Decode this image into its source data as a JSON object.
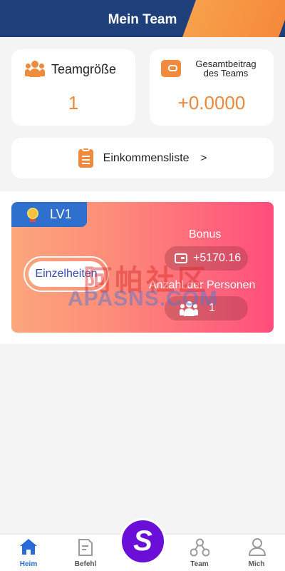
{
  "header": {
    "title": "Mein Team"
  },
  "stats": {
    "team_size": {
      "label": "Teamgröße",
      "value": "1",
      "icon": "people-icon"
    },
    "team_contribution": {
      "label_line1": "Gesamtbeitrag",
      "label_line2": "des Teams",
      "value": "+0.0000",
      "icon": "wallet-icon"
    }
  },
  "income_list": {
    "label": "Einkommensliste",
    "arrow": ">",
    "icon": "clipboard-icon"
  },
  "level": {
    "tag": "LV1",
    "details_button": "Einzelheiten",
    "bonus_label": "Bonus",
    "bonus_value": "+5170.16",
    "persons_label": "Anzahl der Personen",
    "persons_value": "1"
  },
  "watermark": {
    "chinese": "阿帕社区",
    "latin": "APASNS.COM"
  },
  "nav": {
    "home": "Heim",
    "order": "Befehl",
    "center": "S",
    "team": "Team",
    "me": "Mich"
  },
  "colors": {
    "header": "#1f3f7a",
    "accent_orange": "#f08a3c",
    "value_orange": "#e8893f",
    "nav_active": "#2a6ad6",
    "center_button": "#6b0fd8"
  }
}
